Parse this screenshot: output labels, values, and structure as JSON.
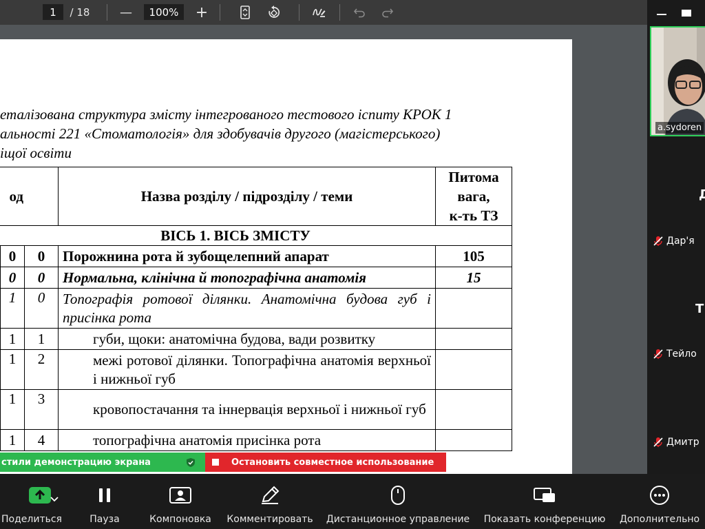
{
  "pdf_toolbar": {
    "page_current": "1",
    "page_total": "/ 18",
    "zoom_out": "—",
    "zoom_value": "100%",
    "zoom_in": "+"
  },
  "document": {
    "title_lines": [
      "еталізована структура змісту інтегрованого тестового іспиту КРОК 1",
      "альності 221 «Стоматологія» для здобувачів другого (магістерського)",
      "іщої освіти"
    ],
    "header": {
      "col_code": "од",
      "col_name": "Назва розділу / підрозділу / теми",
      "col_weight_lines": [
        "Питома",
        "вага,",
        "к-ть ТЗ"
      ]
    },
    "axis_row": "ВІСЬ 1. ВІСЬ ЗМІСТУ",
    "rows": [
      {
        "c2": "0",
        "c3": "0",
        "name": "Порожнина рота й зубощелепний апарат",
        "weight": "105",
        "style": "b"
      },
      {
        "c2": "0",
        "c3": "0",
        "name": "Нормальна, клінічна й топографічна анатомія",
        "weight": "15",
        "style": "bi"
      },
      {
        "c2": "1",
        "c3": "0",
        "name": "Топографія ротової ділянки. Анатомічна будова губ і присінка рота",
        "weight": "",
        "style": "it"
      },
      {
        "c2": "1",
        "c3": "1",
        "name": "губи, щоки: анатомічна будова, вади розвитку",
        "weight": "",
        "style": "ind"
      },
      {
        "c2": "1",
        "c3": "2",
        "name": "межі ротової ділянки. Топографічна анатомія верхньої і нижньої губ",
        "weight": "",
        "style": "ind"
      },
      {
        "c2": "1",
        "c3": "3",
        "name": "кровопостачання та іннервація верхньої і нижньої губ",
        "weight": "",
        "style": "ind"
      },
      {
        "c2": "1",
        "c3": "4",
        "name": "топографічна анатомія присінка рота",
        "weight": "",
        "style": "ind"
      }
    ]
  },
  "video": {
    "self_name": "a.sydoren",
    "participants": [
      {
        "name": "Дар'я",
        "initial": "Д"
      },
      {
        "name": "Тейло",
        "initial": "Т"
      },
      {
        "name": "Дмитр",
        "initial": ""
      }
    ]
  },
  "share": {
    "status": "стили демонстрацию экрана",
    "stop_label": "Остановить совместное использование"
  },
  "bottom_bar": {
    "items": [
      {
        "label": "Поделиться"
      },
      {
        "label": "Пауза"
      },
      {
        "label": "Компоновка"
      },
      {
        "label": "Комментировать"
      },
      {
        "label": "Дистанционное управление"
      },
      {
        "label": "Показать конференцию"
      },
      {
        "label": "Дополнительно"
      }
    ]
  },
  "colors": {
    "share_green": "#2db84f",
    "stop_red": "#e1262b",
    "active_speaker_border": "#2fd05a"
  }
}
